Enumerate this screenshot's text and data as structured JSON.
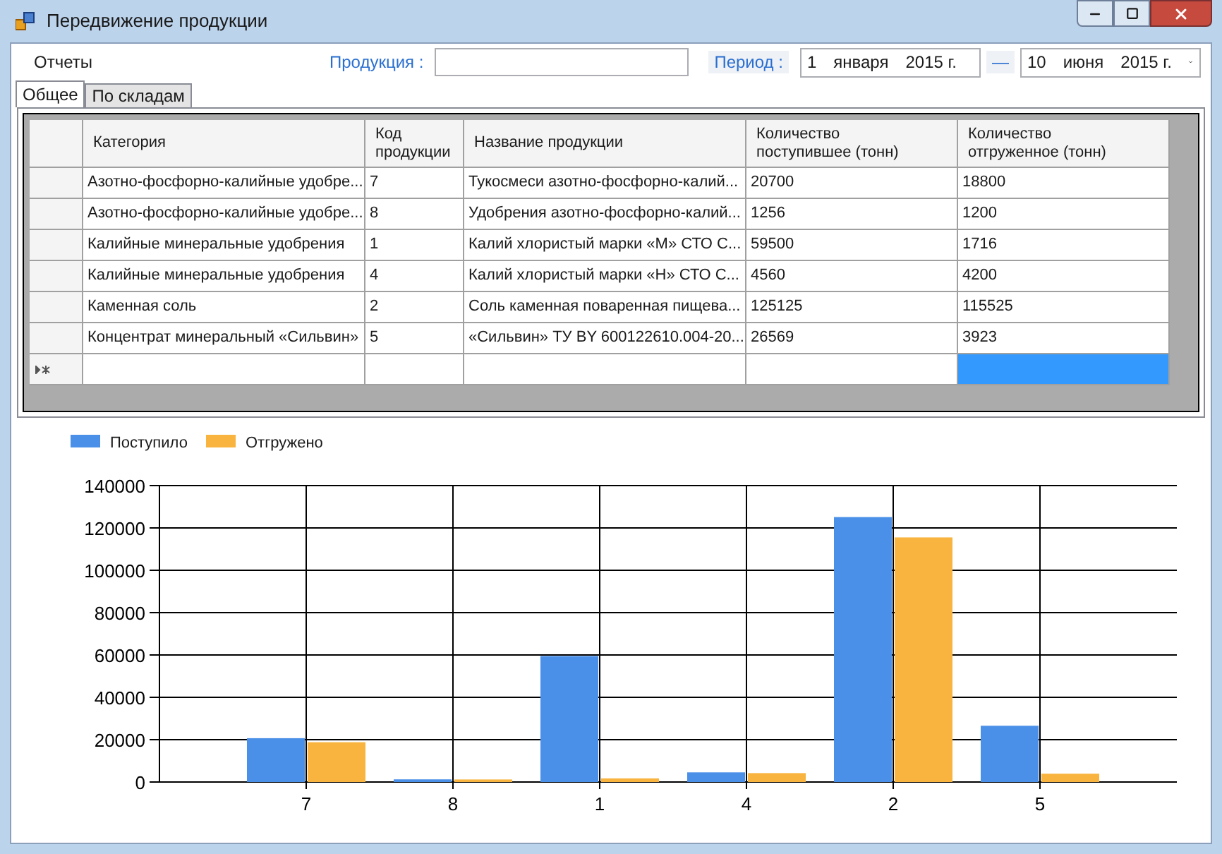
{
  "window": {
    "title": "Передвижение продукции"
  },
  "menu": [
    {
      "label": "Отчеты"
    }
  ],
  "filters": {
    "product_label": "Продукция :",
    "period_label": "Период :",
    "date_from": {
      "day": "1",
      "month": "января",
      "year": "2015 г."
    },
    "separator": "—",
    "date_to": {
      "day": "10",
      "month": "июня",
      "year": "2015 г."
    }
  },
  "tabs": [
    {
      "label": "Общее",
      "selected": true
    },
    {
      "label": "По складам",
      "selected": false
    }
  ],
  "table": {
    "columns": [
      "Категория",
      "Код продукции",
      "Название продукции",
      "Количество поступившее (тонн)",
      "Количество отгруженное (тонн)"
    ],
    "rows": [
      [
        "Азотно-фосфорно-калийные удобре...",
        "7",
        "Тукосмеси азотно-фосфорно-калий...",
        "20700",
        "18800"
      ],
      [
        "Азотно-фосфорно-калийные удобре...",
        "8",
        "Удобрения азотно-фосфорно-калий...",
        "1256",
        "1200"
      ],
      [
        "Калийные минеральные удобрения",
        "1",
        "Калий хлористый марки «М» СТО С...",
        "59500",
        "1716"
      ],
      [
        "Калийные минеральные удобрения",
        "4",
        "Калий хлористый марки «Н» СТО С...",
        "4560",
        "4200"
      ],
      [
        "Каменная соль",
        "2",
        "Соль каменная поваренная пищева...",
        "125125",
        "115525"
      ],
      [
        "Концентрат минеральный «Сильвин»",
        "5",
        "«Сильвин» ТУ BY 600122610.004-20...",
        "26569",
        "3923"
      ]
    ],
    "new_row": {
      "cells": [
        {
          "selected": false
        },
        {
          "selected": false
        },
        {
          "selected": false
        },
        {
          "selected": false
        },
        {
          "selected": true
        }
      ]
    }
  },
  "chart_data": {
    "type": "bar",
    "categories": [
      "7",
      "8",
      "1",
      "4",
      "2",
      "5"
    ],
    "series": [
      {
        "name": "Поступило",
        "color": "#4a90e8",
        "values": [
          20700,
          1256,
          59500,
          4560,
          125125,
          26569
        ]
      },
      {
        "name": "Отгружено",
        "color": "#f9b43f",
        "values": [
          18800,
          1200,
          1716,
          4200,
          115525,
          3923
        ]
      }
    ],
    "ylim": [
      0,
      140000
    ],
    "grid": true,
    "legend": true,
    "yticks": [
      0,
      20000,
      40000,
      60000,
      80000,
      100000,
      120000,
      140000
    ]
  }
}
